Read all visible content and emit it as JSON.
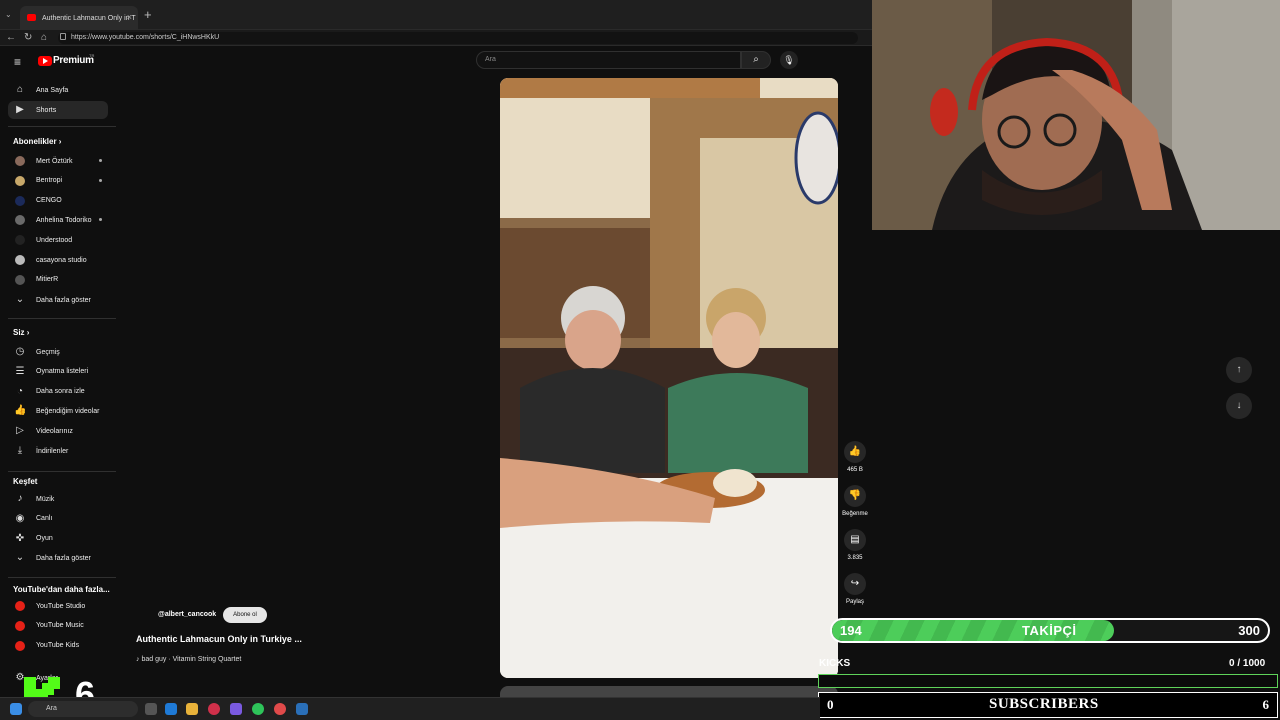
{
  "browser": {
    "tab_title": "Authentic Lahmacun Only in T",
    "url": "https://www.youtube.com/shorts/C_iHNwsHKkU"
  },
  "youtube": {
    "logo_text": "Premium",
    "logo_country": "TR",
    "search_placeholder": "Ara",
    "nav": [
      {
        "label": "Ana Sayfa",
        "icon": "home-icon"
      },
      {
        "label": "Shorts",
        "icon": "shorts-icon"
      }
    ],
    "subscriptions_title": "Abonelikler",
    "subscriptions": [
      {
        "label": "Mert Öztürk",
        "color": "#8a6a5c",
        "live": true
      },
      {
        "label": "Bentropi",
        "color": "#c8a86a",
        "live": true
      },
      {
        "label": "CENGO",
        "color": "#1b2a5a",
        "live": false
      },
      {
        "label": "Anhelina Todoriko",
        "color": "#6a6a6a",
        "live": true
      },
      {
        "label": "Understood",
        "color": "#222222",
        "live": false
      },
      {
        "label": "casayona studio",
        "color": "#bbbbbb",
        "live": false
      },
      {
        "label": "MitierR",
        "color": "#555555",
        "live": false
      }
    ],
    "show_more": "Daha fazla göster",
    "you_title": "Siz",
    "you_items": [
      {
        "label": "Geçmiş",
        "icon": "history-icon"
      },
      {
        "label": "Oynatma listeleri",
        "icon": "playlist-icon"
      },
      {
        "label": "Daha sonra izle",
        "icon": "clock-icon"
      },
      {
        "label": "Beğendiğim videolar",
        "icon": "like-icon"
      },
      {
        "label": "Videolarınız",
        "icon": "video-icon"
      },
      {
        "label": "İndirilenler",
        "icon": "download-icon"
      }
    ],
    "explore_title": "Keşfet",
    "explore_items": [
      {
        "label": "Müzik",
        "icon": "music-icon"
      },
      {
        "label": "Canlı",
        "icon": "live-icon"
      },
      {
        "label": "Oyun",
        "icon": "gaming-icon"
      }
    ],
    "explore_show_more": "Daha fazla göster",
    "more_title": "YouTube'dan daha fazla...",
    "more_items": [
      "YouTube Studio",
      "YouTube Music",
      "YouTube Kids"
    ],
    "settings": "Ayarlar",
    "short": {
      "channel": "@albert_cancook",
      "subscribe": "Abone ol",
      "title": "Authentic Lahmacun Only in Turkiye ...",
      "music": "♪ bad guy · Vitamin String Quartet",
      "likes": "465 B",
      "dislike": "Beğenme",
      "comments": "3.835",
      "share": "Paylaş"
    }
  },
  "overlay": {
    "follower_current": "194",
    "follower_label": "TAKİPÇİ",
    "follower_goal": "300",
    "follower_progress": 0.647,
    "kicks_label": "KICKS",
    "kicks_count": "0  / 1000",
    "subs_current": "0",
    "subs_label": "SUBSCRIBERS",
    "subs_goal": "6",
    "kick_count": "6"
  },
  "taskbar": {
    "search": "Ara"
  }
}
